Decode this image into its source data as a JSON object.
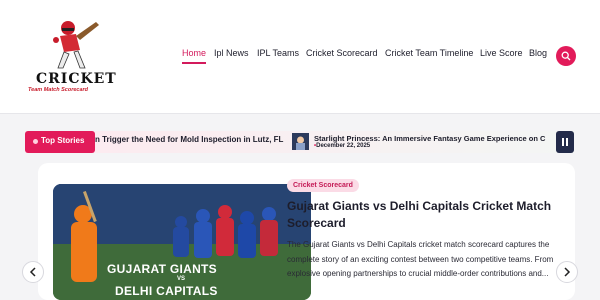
{
  "brand": {
    "name": "Cricket",
    "tagline": "Team Match Scorecard"
  },
  "nav": {
    "items": [
      {
        "label": "Home",
        "active": true
      },
      {
        "label": "Ipl News"
      },
      {
        "label": "IPL Teams"
      },
      {
        "label": "Cricket Scorecard"
      },
      {
        "label": "Cricket Team Timeline"
      },
      {
        "label": "Live Score"
      },
      {
        "label": "Blog"
      }
    ],
    "search_icon": "search-icon",
    "accent": "#e21b5a"
  },
  "ticker": {
    "badge": "Top Stories",
    "items": [
      {
        "title": "n Trigger the Need for Mold Inspection in Lutz, FL"
      },
      {
        "title": "Starlight Princess: An Immersive Fantasy Game Experience on C",
        "date": "December 22, 2025"
      }
    ],
    "pause_icon": "pause-icon"
  },
  "featured": {
    "category": "Cricket Scorecard",
    "title": "Gujarat Giants vs Delhi Capitals Cricket Match Scorecard",
    "excerpt": "The Gujarat Giants vs Delhi Capitals cricket match scorecard captures the complete story of an exciting contest between two competitive teams. From explosive opening partnerships to crucial middle-order contributions and...",
    "image_text": {
      "team1": "GUJARAT GIANTS",
      "vs": "VS",
      "team2": "DELHI CAPITALS"
    }
  },
  "slider": {
    "prev_icon": "chevron-left-icon",
    "next_icon": "chevron-right-icon"
  }
}
